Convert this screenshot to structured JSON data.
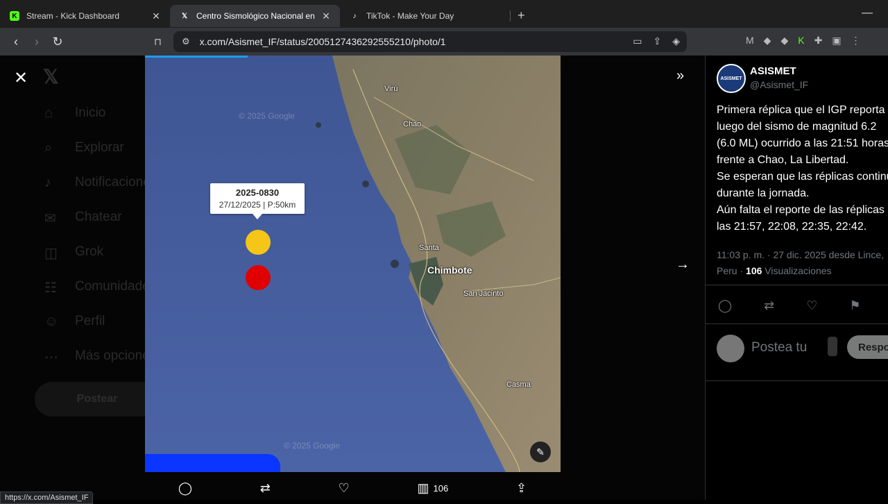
{
  "browser": {
    "tabs": [
      {
        "title": "Stream - Kick Dashboard",
        "icon": "kick-icon"
      },
      {
        "title": "Centro Sismológico Nacional en",
        "icon": "x-icon"
      },
      {
        "title": "TikTok - Make Your Day",
        "icon": "tiktok-icon"
      }
    ],
    "url": "x.com/Asismet_IF/status/2005127436292555210/photo/1",
    "status_url": "https://x.com/Asismet_IF"
  },
  "sidebar_ghost": {
    "items": [
      "Inicio",
      "Explorar",
      "Notificaciones",
      "Chatear",
      "Grok",
      "Comunidades",
      "Perfil",
      "Más opciones"
    ],
    "post_button": "Postear"
  },
  "map": {
    "popup_id": "2025-0830",
    "popup_sub": "27/12/2025 | P:50km",
    "places": [
      "Virú",
      "Chao",
      "Santa",
      "Chimbote",
      "San Jacinto",
      "Casma"
    ],
    "watermark": "© 2025 Google",
    "colors": {
      "ocean": "#4a5f98",
      "yellow_dot": "#f5c518",
      "red_dot": "#e00000",
      "blue_bar": "#0a36ff"
    }
  },
  "photo_actions": {
    "views": "106"
  },
  "post": {
    "author": "ASISMET",
    "handle": "@Asismet_IF",
    "avatar_text": "ASISMET",
    "lines": [
      "Primera réplica que el IGP reporta",
      "luego del sismo de magnitud 6.2",
      "(6.0 ML) ocurrido a las 21:51 horas",
      "frente a Chao, La Libertad.",
      "Se esperan que las réplicas continúen",
      "durante la jornada.",
      "Aún falta el reporte de las réplicas de",
      "las 21:57, 22:08, 22:35, 22:42."
    ],
    "timestamp": "11:03 p. m. · 27 dic. 2025 desde Lince,",
    "location": "Peru",
    "views_count": "106",
    "views_label": "Visualizaciones",
    "reply_placeholder": "Postea tu",
    "reply_button": "Respo"
  }
}
